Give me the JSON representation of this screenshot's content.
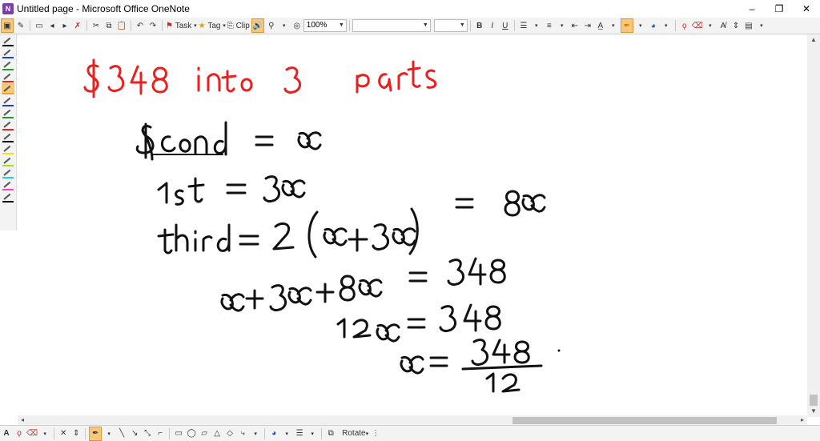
{
  "window": {
    "title": "Untitled page - Microsoft Office OneNote",
    "controls": [
      "–",
      "❐",
      "✕"
    ]
  },
  "toolbar": {
    "task_label": "Task",
    "tag_label": "Tag",
    "clip_label": "Clip",
    "zoom_value": "100%",
    "font_value": "",
    "size_value": "",
    "bold": "B",
    "italic": "I",
    "underline": "U"
  },
  "drawing_toolbar": {
    "text_tool": "A",
    "rotate_label": "Rotate"
  },
  "colors": {
    "ink_red": "#e8211f",
    "ink_black": "#111111",
    "highlight": "#f6c87a",
    "pen_colors": [
      "#000000",
      "#1c3fd6",
      "#1c9d2d",
      "#e8211f",
      "#f6a21a",
      "#1c3fd6",
      "#1c9d2d",
      "#e8211f",
      "#000000",
      "#f0e020",
      "#9fe020",
      "#20d0e0",
      "#ff40c0",
      "#000000"
    ]
  },
  "note_content": {
    "handwritten_lines": [
      "$348 into 3 parts",
      "second = x",
      "1st = 3x",
      "third = 2(x+3x) = 8x",
      "x+3x+8x = 348",
      "12x = 348",
      "x = 348/12"
    ]
  }
}
